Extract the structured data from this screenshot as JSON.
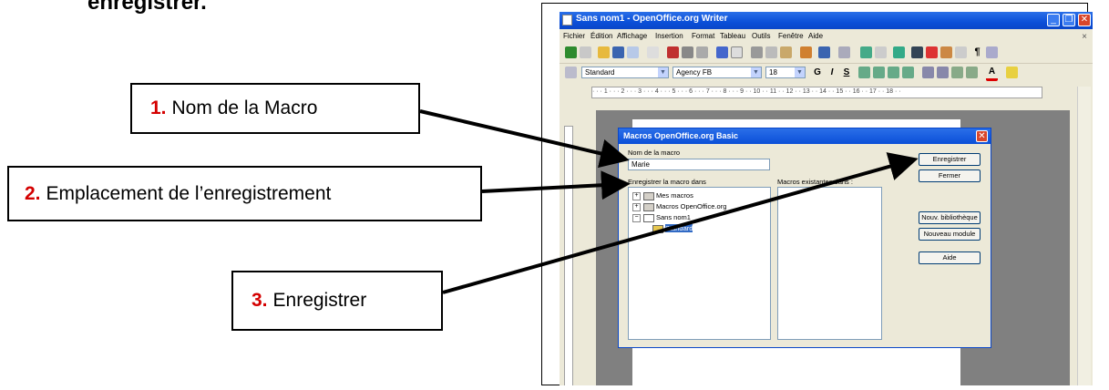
{
  "heading": "enregistrer.",
  "callouts": [
    {
      "num": "1.",
      "text": "Nom de la Macro"
    },
    {
      "num": "2.",
      "text": "Emplacement de l’enregistrement"
    },
    {
      "num": "3.",
      "text": "Enregistrer"
    }
  ],
  "window": {
    "title": "Sans nom1 - OpenOffice.org Writer",
    "menu": [
      "Fichier",
      "Édition",
      "Affichage",
      "Insertion",
      "Format",
      "Tableau",
      "Outils",
      "Fenêtre",
      "Aide"
    ],
    "style_value": "Standard",
    "font_value": "Agency FB",
    "size_value": "18",
    "ruler_text": "· · · 1 · · · 2 · · · 3 · · · 4 · · · 5 · · · 6 · · · 7 · · · 8 · · · 9 · · 10 · · 11 · · 12 · · 13 · · 14 · · 15 · · 16 · · 17 · · 18 · ·"
  },
  "dialog": {
    "title": "Macros OpenOffice.org Basic",
    "name_label": "Nom de la macro",
    "name_value": "Marie",
    "save_in_label": "Enregistrer la macro dans",
    "existing_label": "Macros existantes dans :",
    "tree": [
      "Mes macros",
      "Macros OpenOffice.org",
      "Sans nom1",
      "Standard"
    ],
    "buttons": {
      "save": "Enregistrer",
      "close": "Fermer",
      "new_library": "Nouv. bibliothèque",
      "new_module": "Nouveau module",
      "help": "Aide"
    }
  },
  "colors": {
    "callout_number": "#d40000",
    "title_blue": "#0b4fd8"
  }
}
